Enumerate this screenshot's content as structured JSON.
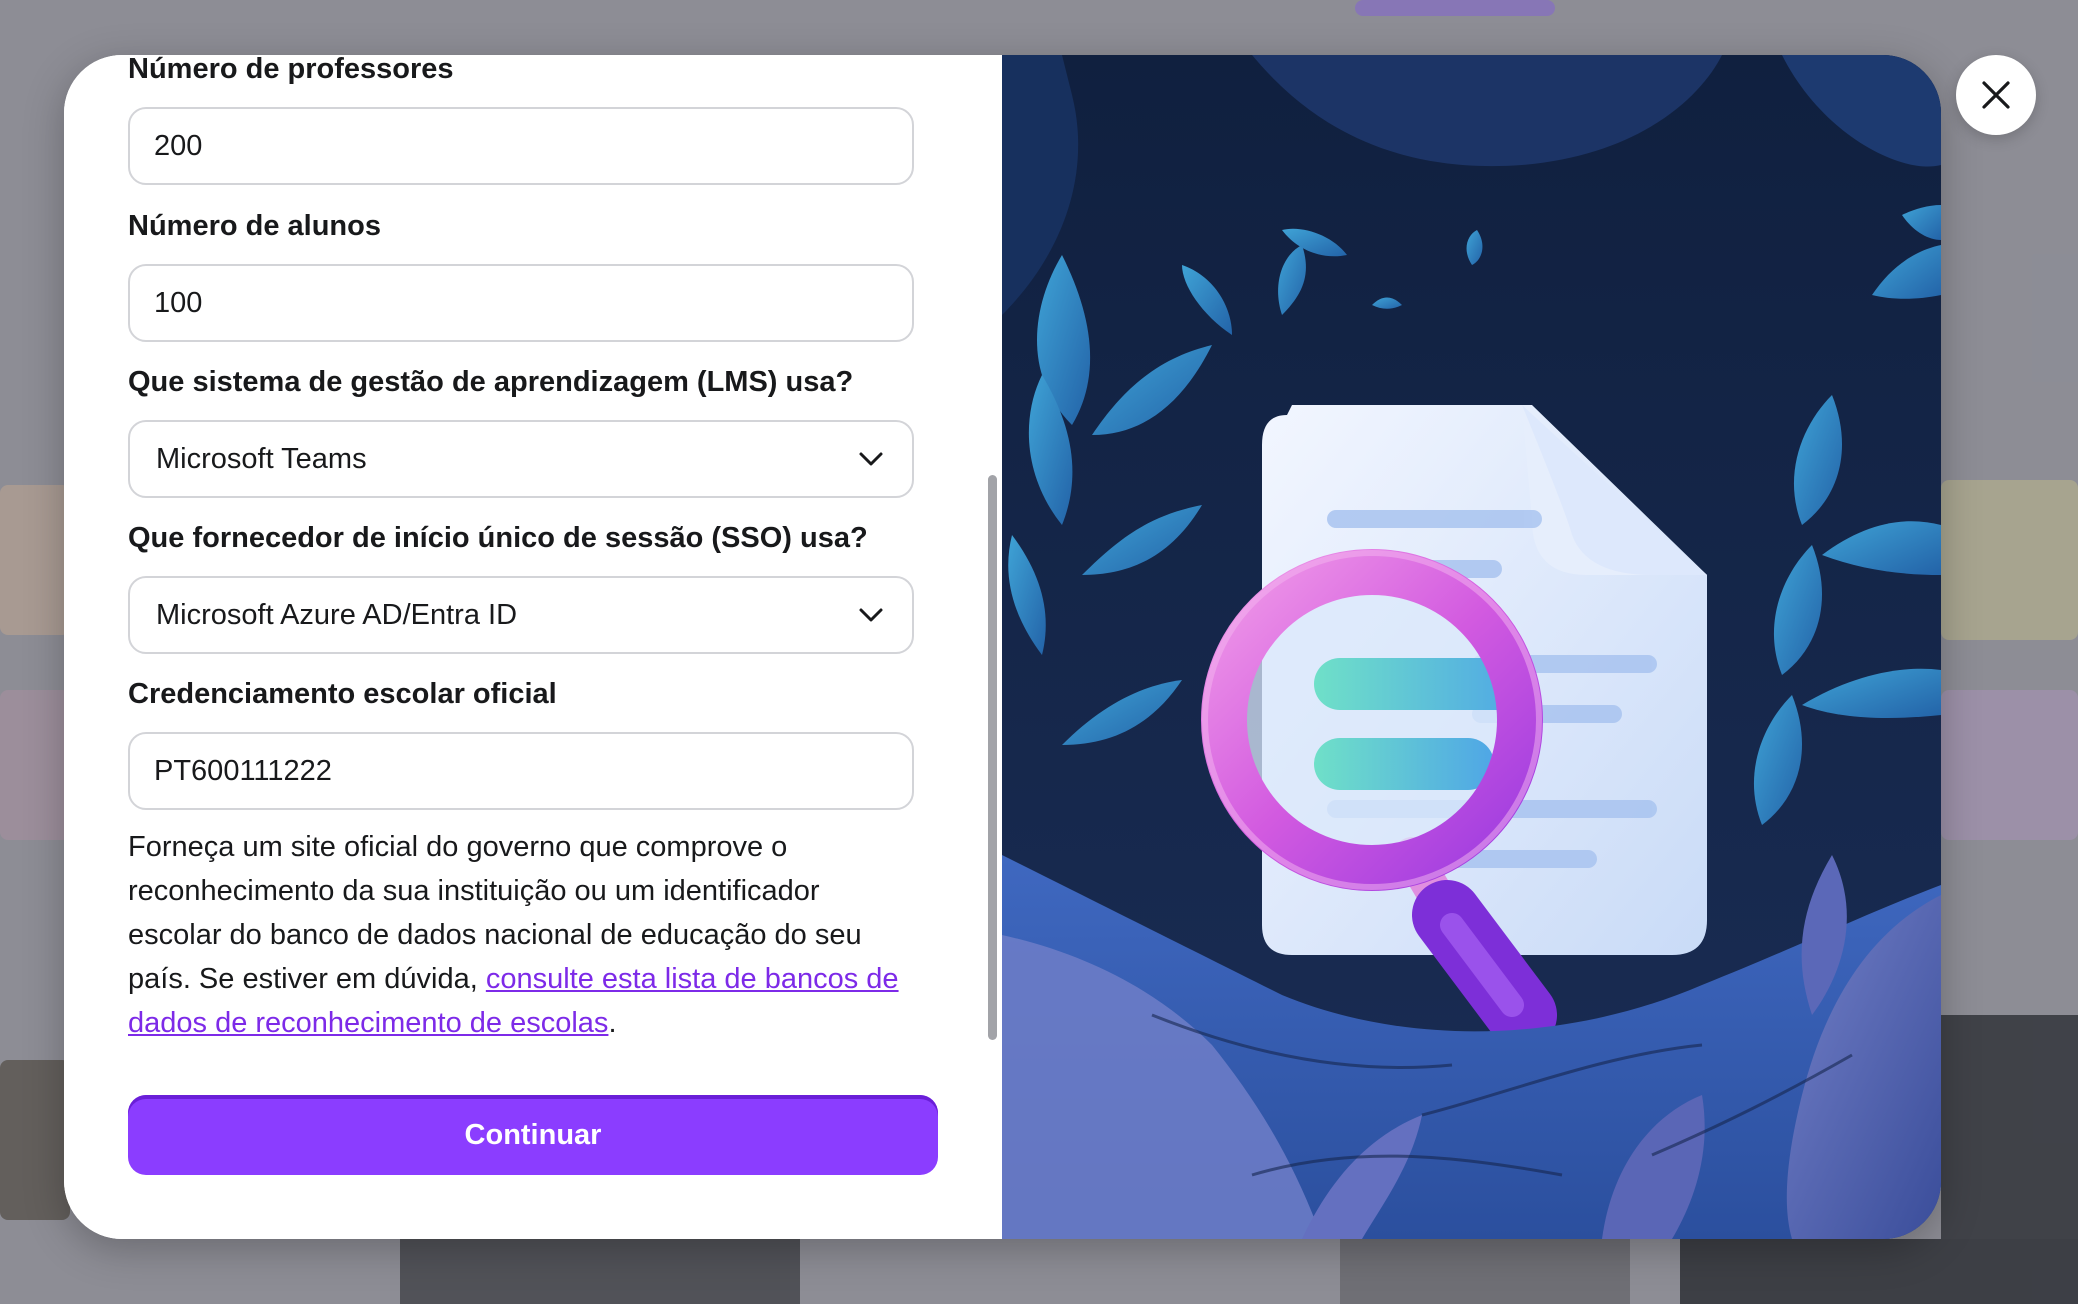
{
  "form": {
    "teachers_label": "Número de professores",
    "teachers_value": "200",
    "students_label": "Número de alunos",
    "students_value": "100",
    "lms_label": "Que sistema de gestão de aprendizagem (LMS) usa?",
    "lms_value": "Microsoft Teams",
    "sso_label": "Que fornecedor de início único de sessão (SSO) usa?",
    "sso_value": "Microsoft Azure AD/Entra ID",
    "accreditation_label": "Credenciamento escolar oficial",
    "accreditation_value": "PT600111222",
    "help_text": "Forneça um site oficial do governo que comprove o reconhecimento da sua instituição ou um identificador escolar do banco de dados nacional de educação do seu país. Se estiver em dúvida, ",
    "help_link": "consulte esta lista de bancos de dados de reconhecimento de escolas",
    "help_end": ".",
    "continue_label": "Continuar"
  },
  "icons": {
    "select_chevron": "chevron-down-icon",
    "close": "close-icon",
    "illustration": "document-magnifier-illustration"
  },
  "colors": {
    "accent": "#8b3dff",
    "link": "#7d2ae8",
    "text": "#18191b",
    "illustration_bg": "#14264a"
  }
}
